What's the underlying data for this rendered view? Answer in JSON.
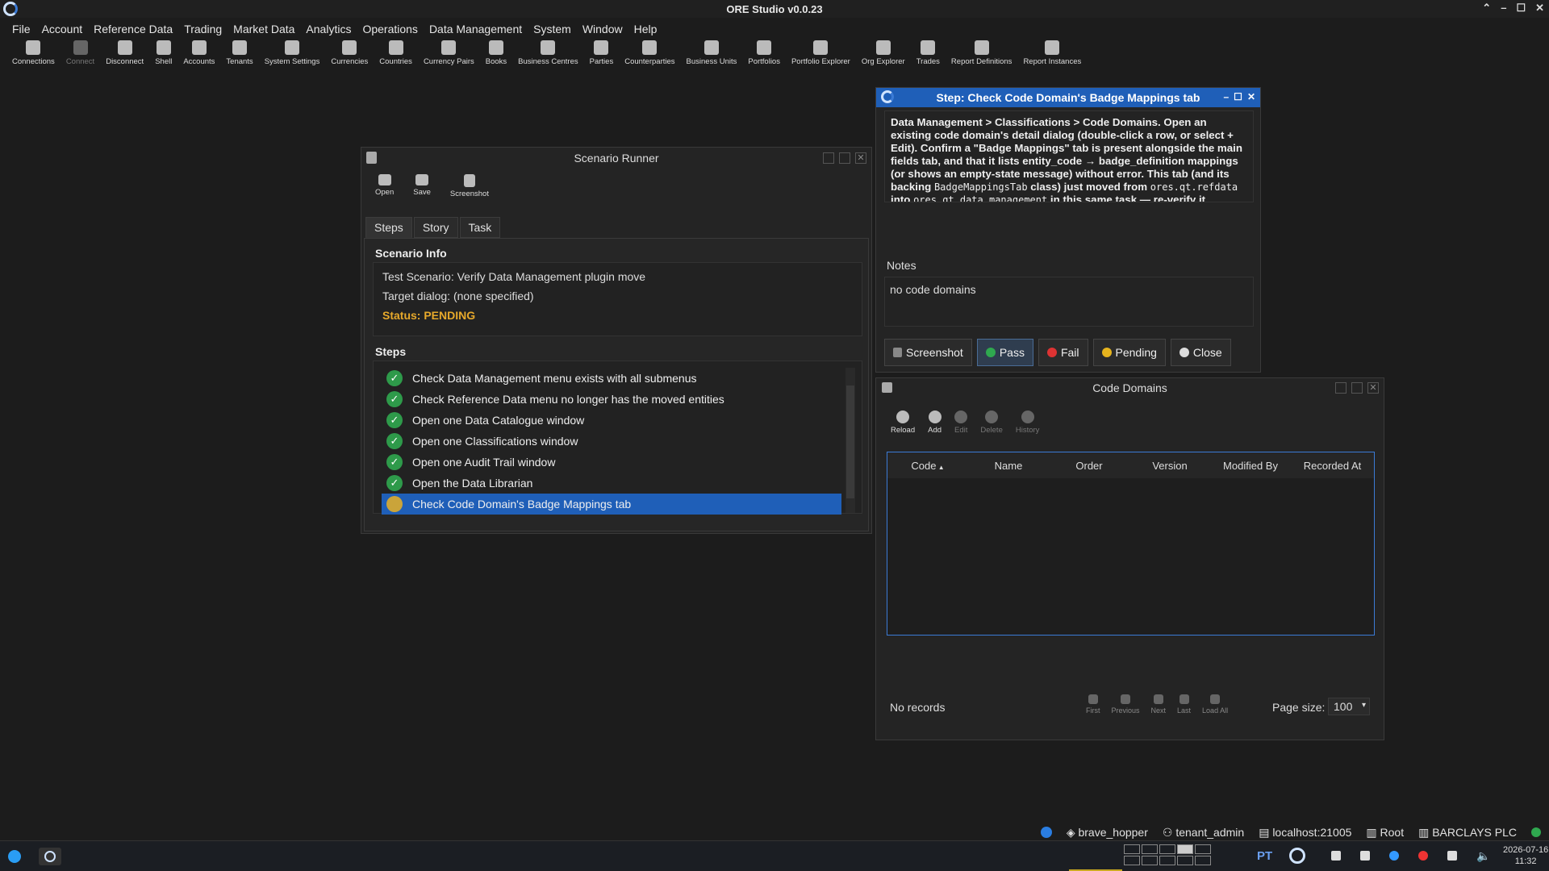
{
  "app": {
    "title": "ORE Studio v0.0.23"
  },
  "menu": [
    "File",
    "Account",
    "Reference Data",
    "Trading",
    "Market Data",
    "Analytics",
    "Operations",
    "Data Management",
    "System",
    "Window",
    "Help"
  ],
  "toolbar": [
    {
      "label": "Connections",
      "icon": "connections-icon"
    },
    {
      "label": "Connect",
      "icon": "connect-icon",
      "disabled": true
    },
    {
      "label": "Disconnect",
      "icon": "disconnect-icon"
    },
    {
      "label": "Shell",
      "icon": "shell-icon"
    },
    {
      "label": "Accounts",
      "icon": "accounts-icon"
    },
    {
      "label": "Tenants",
      "icon": "tenants-icon"
    },
    {
      "label": "System Settings",
      "icon": "flag-icon"
    },
    {
      "label": "Currencies",
      "icon": "currency-icon"
    },
    {
      "label": "Countries",
      "icon": "globe-icon"
    },
    {
      "label": "Currency Pairs",
      "icon": "currency-pairs-icon"
    },
    {
      "label": "Books",
      "icon": "books-icon"
    },
    {
      "label": "Business Centres",
      "icon": "building-icon"
    },
    {
      "label": "Parties",
      "icon": "parties-icon"
    },
    {
      "label": "Counterparties",
      "icon": "handshake-icon"
    },
    {
      "label": "Business Units",
      "icon": "business-units-icon"
    },
    {
      "label": "Portfolios",
      "icon": "portfolio-icon"
    },
    {
      "label": "Portfolio Explorer",
      "icon": "portfolio-explorer-icon"
    },
    {
      "label": "Org Explorer",
      "icon": "org-explorer-icon"
    },
    {
      "label": "Trades",
      "icon": "trades-icon"
    },
    {
      "label": "Report Definitions",
      "icon": "report-definitions-icon"
    },
    {
      "label": "Report Instances",
      "icon": "report-instances-icon"
    }
  ],
  "runner": {
    "title": "Scenario Runner",
    "actions": [
      "Open",
      "Save",
      "Screenshot"
    ],
    "tabs": [
      "Steps",
      "Story",
      "Task"
    ],
    "info_heading": "Scenario Info",
    "scenario": "Test Scenario: Verify Data Management plugin move",
    "target": "Target dialog: (none specified)",
    "status": "Status: PENDING",
    "steps_heading": "Steps",
    "steps": [
      {
        "label": "Check Data Management menu exists with all submenus",
        "state": "pass"
      },
      {
        "label": "Check Reference Data menu no longer has the moved entities",
        "state": "pass"
      },
      {
        "label": "Open one Data Catalogue window",
        "state": "pass"
      },
      {
        "label": "Open one Classifications window",
        "state": "pass"
      },
      {
        "label": "Open one Audit Trail window",
        "state": "pass"
      },
      {
        "label": "Open the Data Librarian",
        "state": "pass"
      },
      {
        "label": "Check Code Domain's Badge Mappings tab",
        "state": "pending"
      }
    ]
  },
  "step_dialog": {
    "title": "Step: Check Code Domain's Badge Mappings tab",
    "description": [
      {
        "t": "Data Management > Classifications > Code Domains. Open an existing code domain's detail dialog (double-click a row, or select + Edit). Confirm a \"Badge Mappings\" tab is present alongside the main fields tab, and that it lists entity_code → badge_definition mappings (or shows an empty-state message) without error. This tab (and its backing ",
        "mono": false
      },
      {
        "t": "BadgeMappingsTab",
        "mono": true
      },
      {
        "t": " class) just moved from ",
        "mono": false
      },
      {
        "t": "ores.qt.refdata",
        "mono": true
      },
      {
        "t": " into ",
        "mono": false
      },
      {
        "t": "ores.qt.data_management",
        "mono": true
      },
      {
        "t": " in this same task — re-verify it specifically since it wasn't covered by the first pass of this scenario.",
        "mono": false
      }
    ],
    "notes_label": "Notes",
    "notes": "no code domains",
    "buttons": {
      "screenshot": "Screenshot",
      "pass": "Pass",
      "fail": "Fail",
      "pending": "Pending",
      "close": "Close"
    }
  },
  "code_domains": {
    "title": "Code Domains",
    "actions": [
      {
        "label": "Reload",
        "enabled": true
      },
      {
        "label": "Add",
        "enabled": true
      },
      {
        "label": "Edit",
        "enabled": false
      },
      {
        "label": "Delete",
        "enabled": false
      },
      {
        "label": "History",
        "enabled": false
      }
    ],
    "columns": [
      "Code",
      "Name",
      "Order",
      "Version",
      "Modified By",
      "Recorded At"
    ],
    "empty": "No records",
    "pager": [
      "First",
      "Previous",
      "Next",
      "Last",
      "Load All"
    ],
    "page_size_label": "Page size:",
    "page_size": "100"
  },
  "status": {
    "user": "brave_hopper",
    "tenant": "tenant_admin",
    "server": "localhost:21005",
    "root": "Root",
    "party": "BARCLAYS PLC"
  },
  "taskbar": {
    "lang": "PT",
    "date": "2026-07-16",
    "time": "11:32"
  }
}
